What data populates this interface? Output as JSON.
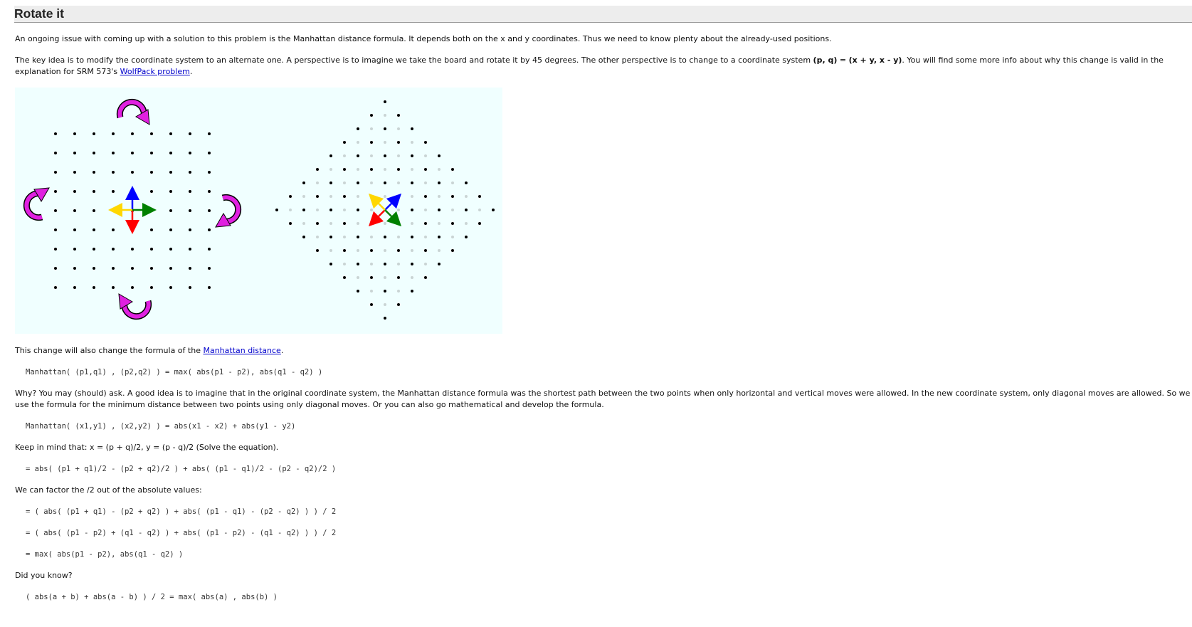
{
  "section": {
    "heading": "Rotate it"
  },
  "para1": "An ongoing issue with coming up with a solution to this problem is the Manhattan distance formula. It depends both on the x and y coordinates. Thus we need to know plenty about the already-used positions.",
  "para2": {
    "before": "The key idea is to modify the coordinate system to an alternate one. A perspective is to imagine we take the board and rotate it by 45 degrees. The other perspective is to change to a coordinate system ",
    "pq": "(p, q)",
    "eq": " = ",
    "xy": "(x + y, x - y)",
    "after": ". You will find some more info about why this change is valid in the explanation for SRM 573's ",
    "link": "WolfPack problem",
    "end": "."
  },
  "figure": {
    "colors": {
      "background": "#f0ffff",
      "dot": "#000000",
      "dot_faint": "#c9d4d4",
      "rotate_arrow": "#e020e0",
      "axis_up": "#0000ff",
      "axis_down": "#ff0000",
      "axis_left": "#ffd700",
      "axis_right": "#008000"
    },
    "left_grid": {
      "rows": 9,
      "cols": 9
    },
    "rotation_icons": [
      "rotate-arrow-top-icon",
      "rotate-arrow-left-icon",
      "rotate-arrow-right-icon",
      "rotate-arrow-bottom-icon"
    ]
  },
  "para3": {
    "before": "This change will also change the formula of the ",
    "link": "Manhattan distance",
    "end": "."
  },
  "code1": "Manhattan( (p1,q1) , (p2,q2) ) = max( abs(p1 - p2), abs(q1 - q2) )",
  "para4": "Why? You may (should) ask. A good idea is to imagine that in the original coordinate system, the Manhattan distance formula was the shortest path between the two points when only horizontal and vertical moves were allowed. In the new coordinate system, only diagonal moves are allowed. So we use the formula for the minimum distance between two points using only diagonal moves. Or you can also go mathematical and develop the formula.",
  "code2": "Manhattan( (x1,y1) , (x2,y2) ) = abs(x1 - x2) + abs(y1 - y2)",
  "para5": "Keep in mind that: x = (p + q)/2, y = (p - q)/2 (Solve the equation).",
  "code3": "= abs( (p1 + q1)/2 - (p2 + q2)/2 ) + abs( (p1 - q1)/2 - (p2 - q2)/2 )",
  "para6": "We can factor the /2 out of the absolute values:",
  "code4": "= ( abs( (p1 + q1) - (p2 + q2) ) + abs( (p1 - q1) - (p2 - q2) ) ) / 2",
  "code5": "= ( abs( (p1 - p2) + (q1 - q2) ) + abs( (p1 - p2) - (q1 - q2) ) ) / 2",
  "code6": "= max( abs(p1 - p2), abs(q1 - q2) )",
  "para7": "Did you know?",
  "code7": "( abs(a + b) + abs(a - b) ) / 2 = max( abs(a) , abs(b) )"
}
